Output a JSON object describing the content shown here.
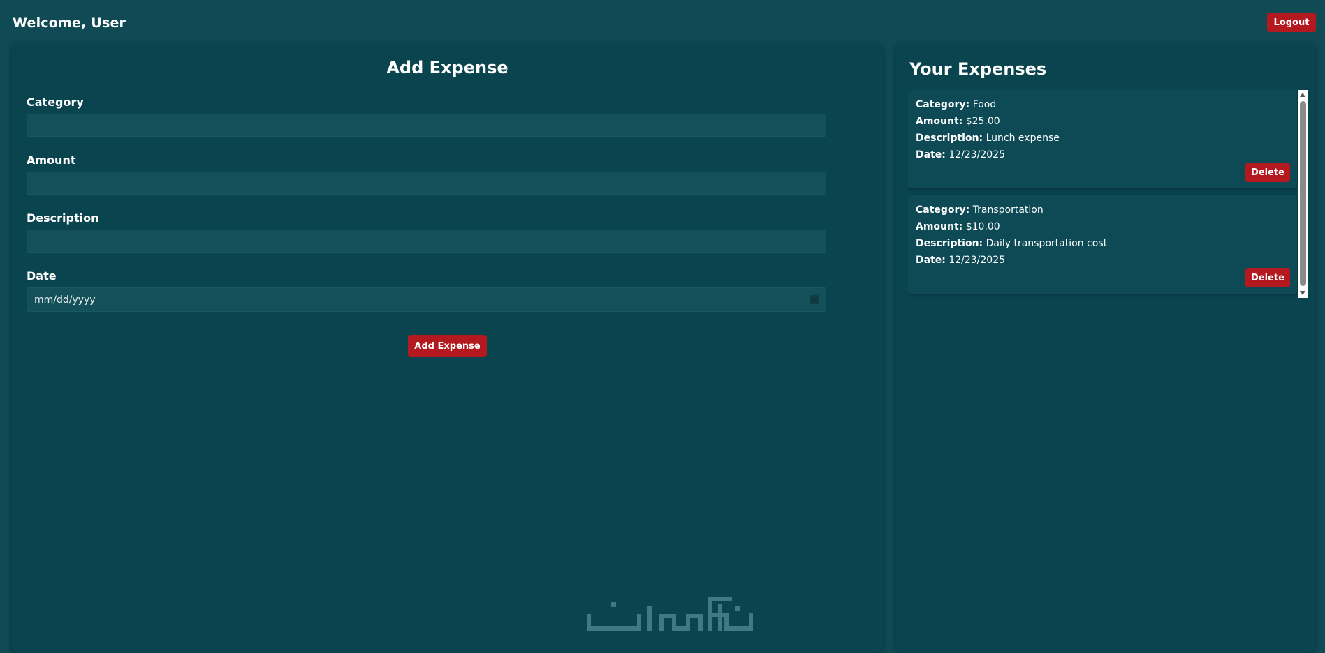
{
  "header": {
    "welcome": "Welcome, User",
    "logout_label": "Logout"
  },
  "form": {
    "title": "Add Expense",
    "fields": [
      {
        "label": "Category",
        "value": ""
      },
      {
        "label": "Amount",
        "value": ""
      },
      {
        "label": "Description",
        "value": ""
      },
      {
        "label": "Date",
        "placeholder": "mm/dd/yyyy"
      }
    ],
    "submit_label": "Add Expense"
  },
  "expenses": {
    "title": "Your Expenses",
    "field_labels": {
      "category": "Category:",
      "amount": "Amount:",
      "description": "Description:",
      "date": "Date:"
    },
    "delete_label": "Delete",
    "items": [
      {
        "category": "Food",
        "amount": "$25.00",
        "description": "Lunch expense",
        "date": "12/23/2025"
      },
      {
        "category": "Transportation",
        "amount": "$10.00",
        "description": "Daily transportation cost",
        "date": "12/23/2025"
      }
    ]
  },
  "colors": {
    "background": "#0f4a55",
    "panel": "#09444f",
    "input": "#14505a",
    "button": "#b3191f",
    "text": "#ffffff",
    "watermark": "#3f7a83"
  },
  "watermark": {
    "text": "خمسات",
    "icon": "logo-watermark"
  }
}
